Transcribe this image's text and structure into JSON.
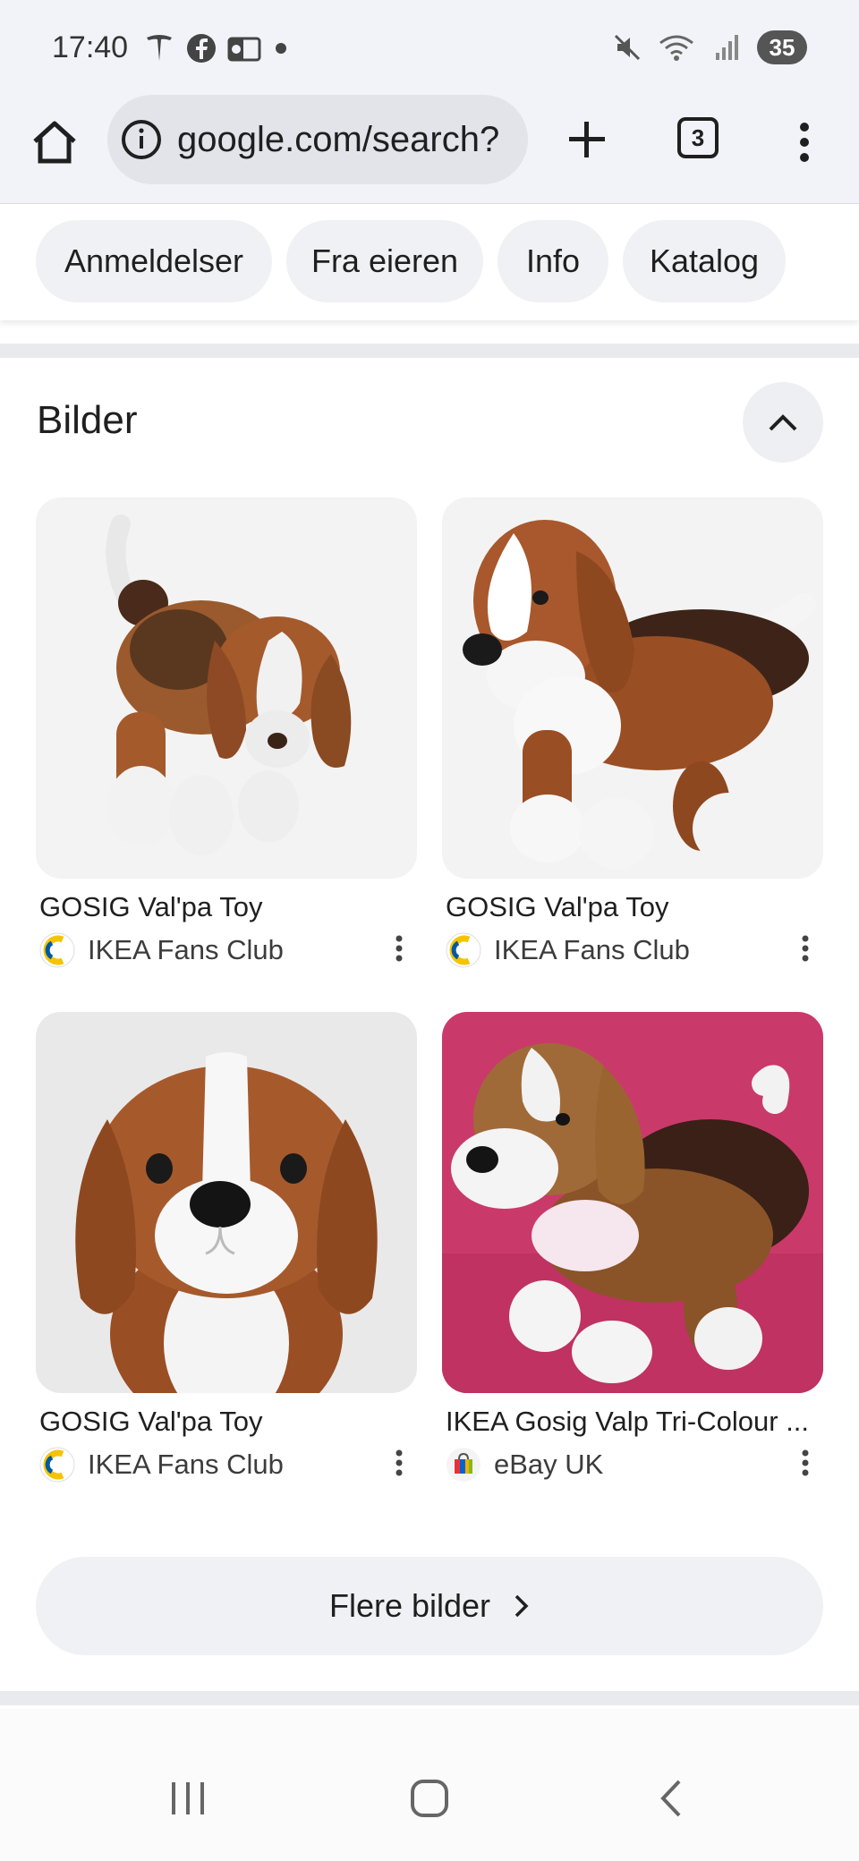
{
  "status_bar": {
    "time": "17:40",
    "battery": "35"
  },
  "browser": {
    "url": "google.com/search?",
    "tab_count": "3"
  },
  "chips": [
    "Anmeldelser",
    "Fra eieren",
    "Info",
    "Katalog"
  ],
  "images_section": {
    "title": "Bilder",
    "items": [
      {
        "title": "GOSIG Val'pa Toy",
        "source": "IKEA Fans Club",
        "source_icon": "ikea-fans-club-icon"
      },
      {
        "title": "GOSIG Val'pa Toy",
        "source": "IKEA Fans Club",
        "source_icon": "ikea-fans-club-icon"
      },
      {
        "title": "GOSIG Val'pa Toy",
        "source": "IKEA Fans Club",
        "source_icon": "ikea-fans-club-icon"
      },
      {
        "title": "IKEA Gosig Valp Tri-Colour ...",
        "source": "eBay UK",
        "source_icon": "ebay-icon"
      }
    ],
    "more_button": "Flere bilder"
  },
  "colors": {
    "toolbar_bg": "#f1f3f8",
    "chip_bg": "#f0f1f4",
    "pink_bg": "#c93a6a"
  }
}
